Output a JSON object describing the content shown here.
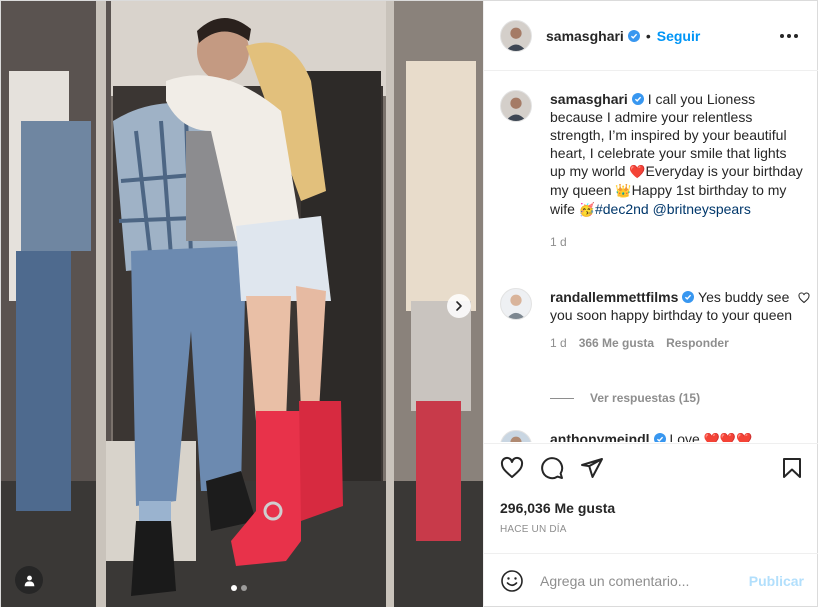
{
  "post": {
    "author": "samasghari",
    "follow_label": "Seguir",
    "separator": "•"
  },
  "caption": {
    "username": "samasghari",
    "text": "I call you Lioness because I admire your relentless strength, I’m inspired by your beautiful heart, I celebrate your smile that lights up my world ",
    "text2": "Everyday is your birthday my queen ",
    "text3": "Happy 1st birthday to my wife ",
    "hashtag": "#dec2nd",
    "mention": "@britneyspears",
    "emoji_heart": "❤️",
    "emoji_crown": "👑",
    "emoji_party": "🥳",
    "time": "1 d"
  },
  "comment1": {
    "username": "randallemmettfilms",
    "text": "Yes buddy see you soon happy birthday to your queen",
    "time": "1 d",
    "likes": "366 Me gusta",
    "reply_label": "Responder",
    "view_replies": "Ver respuestas (15)"
  },
  "comment2": {
    "username": "anthonymeindl",
    "text": "Love ",
    "emoji": "❤️❤️❤️"
  },
  "actions": {
    "likes": "296,036 Me gusta",
    "time": "HACE UN DÍA"
  },
  "add_comment": {
    "placeholder": "Agrega un comentario...",
    "publish_label": "Publicar"
  },
  "carousel": {
    "total": 2,
    "current": 1
  },
  "colors": {
    "accent": "#0095f6",
    "verified": "#3897f0",
    "boots": "#e8324a",
    "muted": "#8e8e8e"
  }
}
